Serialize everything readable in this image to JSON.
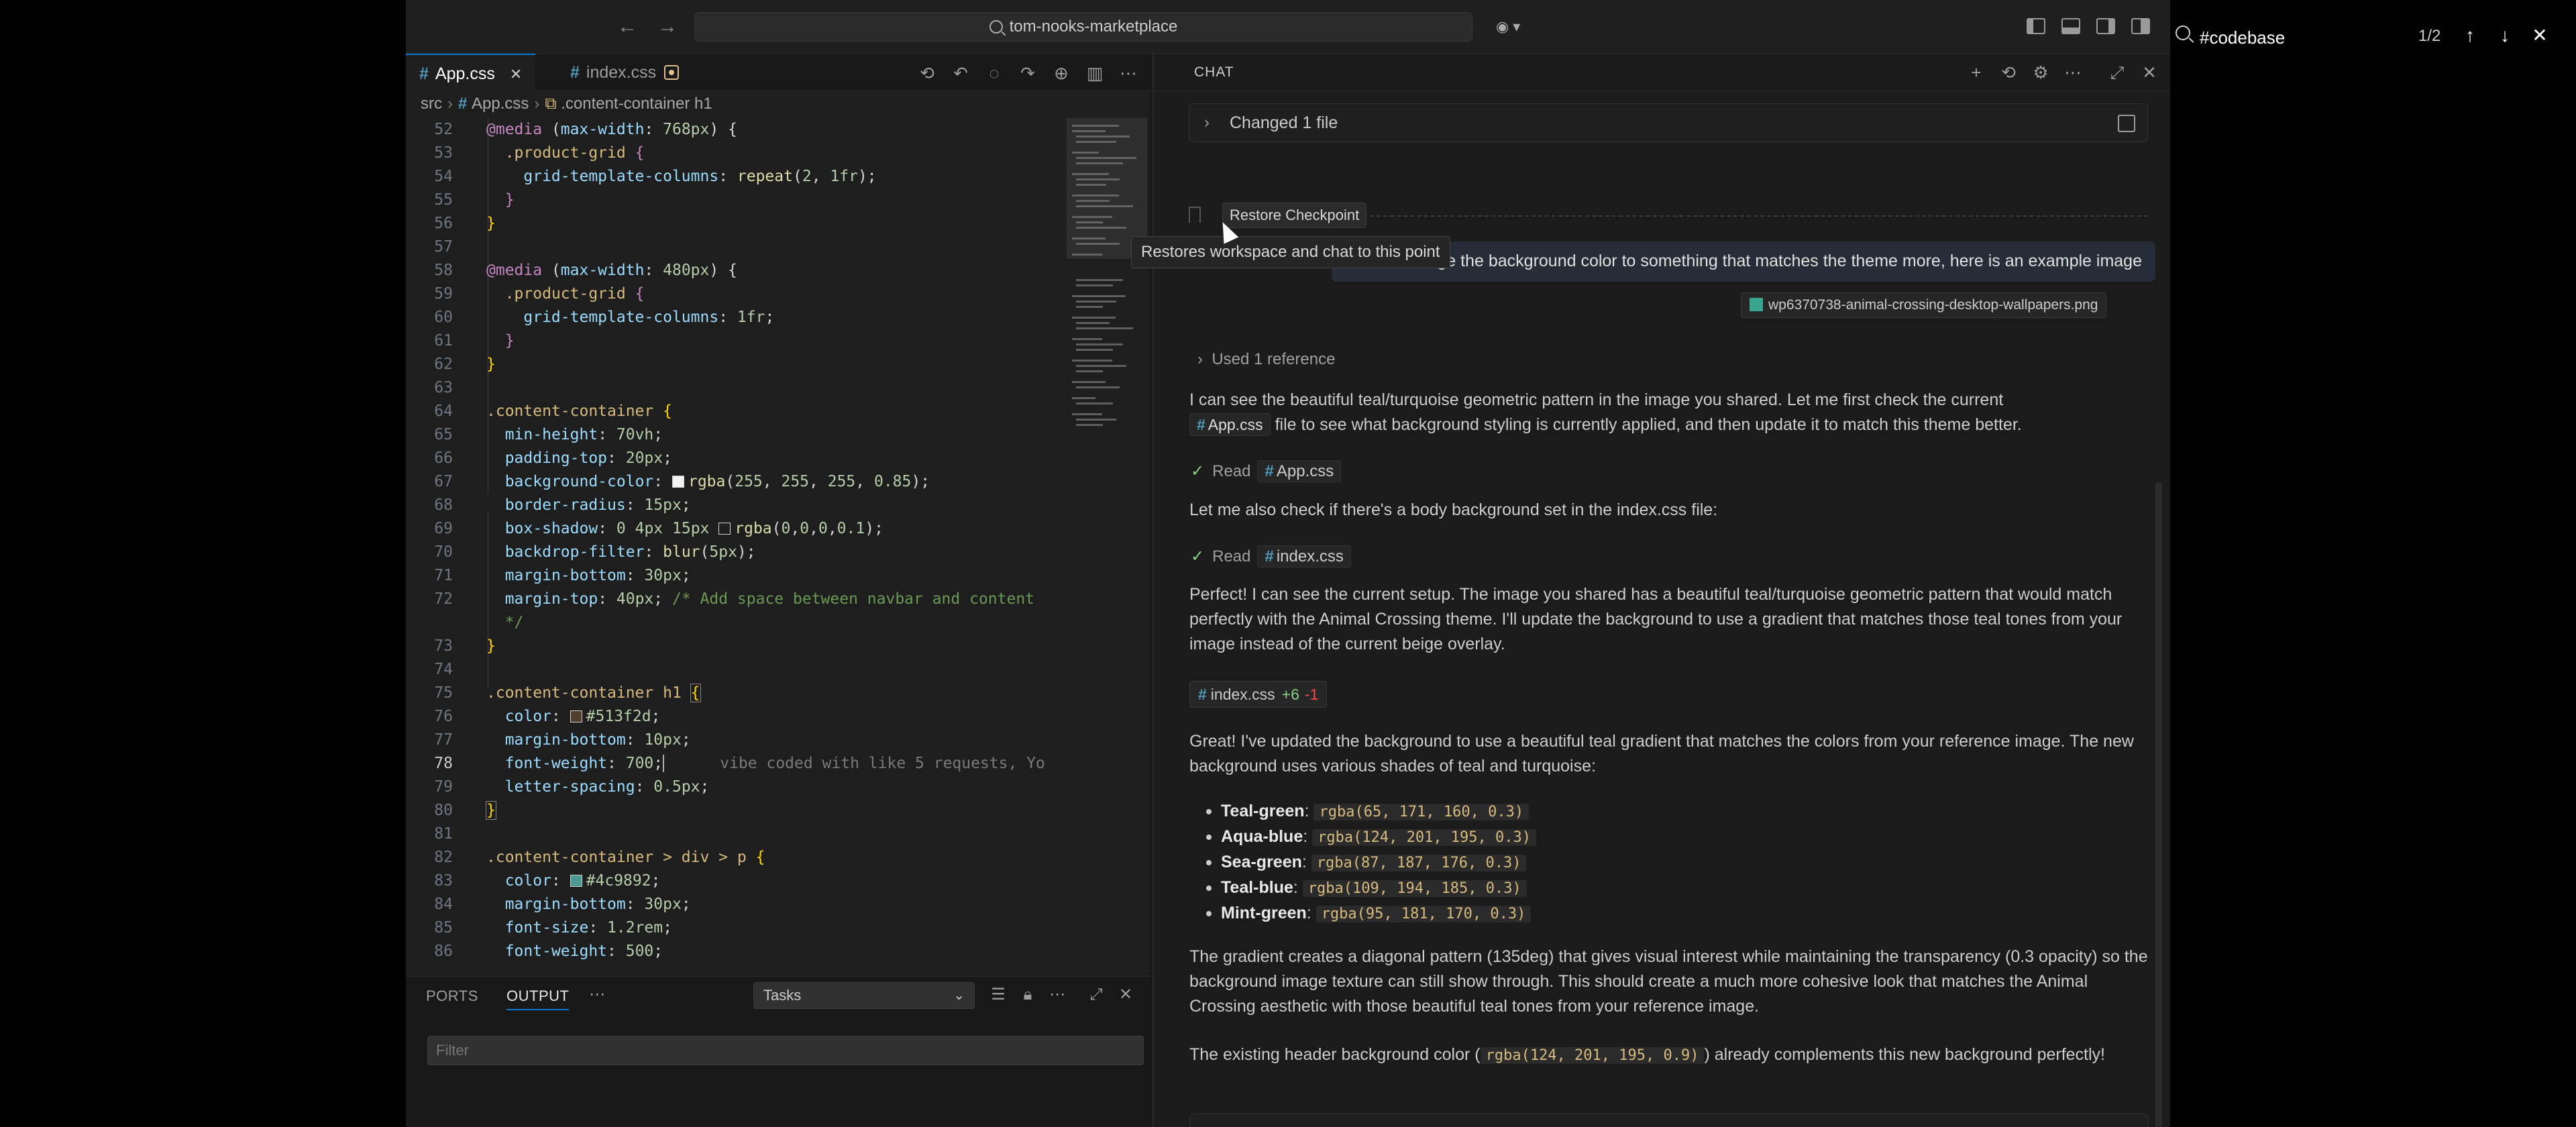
{
  "titlebar": {
    "command_center": "tom-nooks-marketplace",
    "back_icon": "arrow-left-icon",
    "forward_icon": "arrow-right-icon"
  },
  "tabs": [
    {
      "label": "App.css",
      "active": true
    },
    {
      "label": "index.css",
      "active": false
    }
  ],
  "breadcrumb": {
    "folder": "src",
    "file": "App.css",
    "symbol": ".content-container h1"
  },
  "ghost_text": "vibe coded with like 5 requests, Yo",
  "panel": {
    "ports_label": "PORTS",
    "output_label": "OUTPUT",
    "task_select": "Tasks",
    "filter_placeholder": "Filter"
  },
  "chat": {
    "title": "CHAT",
    "changed_files": "Changed 1 file",
    "restore_button": "Restore Checkpoint",
    "restore_tooltip": "Restores workspace and chat to this point",
    "user_message": "change the background color to something that matches the theme more, here is an example image",
    "attachment": "wp6370738-animal-crossing-desktop-wallpapers.png",
    "used_reference": "Used 1 reference",
    "msg1_a": "I can see the beautiful teal/turquoise geometric pattern in the image you shared. Let me first check the current",
    "msg1_chip": "App.css",
    "msg1_b": "file to see what background styling is currently applied, and then update it to match this theme better.",
    "read1_label": "Read",
    "read1_file": "App.css",
    "msg2": "Let me also check if there's a body background set in the index.css file:",
    "read2_label": "Read",
    "read2_file": "index.css",
    "msg3": "Perfect! I can see the current setup. The image you shared has a beautiful teal/turquoise geometric pattern that would match perfectly with the Animal Crossing theme. I'll update the background to use a gradient that matches those teal tones from your image instead of the current beige overlay.",
    "diff_file": "index.css",
    "diff_add": "+6",
    "diff_del": "-1",
    "msg4": "Great! I've updated the background to use a beautiful teal gradient that matches the colors from your reference image. The new background uses various shades of teal and turquoise:",
    "colors": [
      {
        "name": "Teal-green",
        "value": "rgba(65, 171, 160, 0.3)"
      },
      {
        "name": "Aqua-blue",
        "value": "rgba(124, 201, 195, 0.3)"
      },
      {
        "name": "Sea-green",
        "value": "rgba(87, 187, 176, 0.3)"
      },
      {
        "name": "Teal-blue",
        "value": "rgba(109, 194, 185, 0.3)"
      },
      {
        "name": "Mint-green",
        "value": "rgba(95, 181, 170, 0.3)"
      }
    ],
    "msg5": "The gradient creates a diagonal pattern (135deg) that gives visual interest while maintaining the transparency (0.3 opacity) so the background image texture can still show through. This should create a much more cohesive look that matches the Animal Crossing aesthetic with those beautiful teal tones from your reference image.",
    "msg6_a": "The existing header background color (",
    "msg6_code": "rgba(124, 201, 195, 0.9)",
    "msg6_b": ") already complements this new background perfectly!"
  },
  "find": {
    "query": "#codebase",
    "count": "1/2"
  },
  "colors": {
    "accent": "#0078d4",
    "editor_bg": "#1e1e1e",
    "chat_bg": "#1b1b1b"
  }
}
